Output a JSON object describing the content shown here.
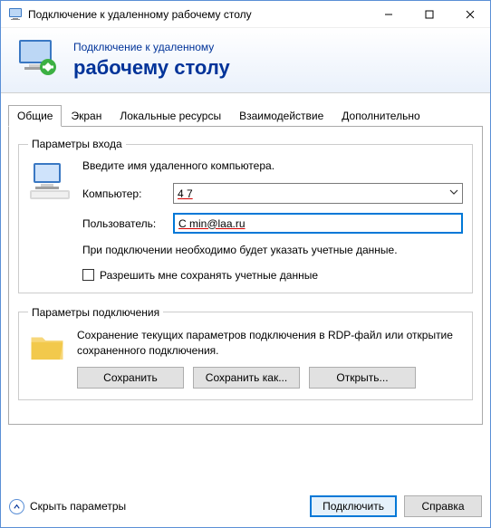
{
  "window": {
    "title": "Подключение к удаленному рабочему столу"
  },
  "header": {
    "line1": "Подключение к удаленному",
    "line2": "рабочему столу"
  },
  "tabs": {
    "general": "Общие",
    "display": "Экран",
    "localres": "Локальные ресурсы",
    "experience": "Взаимодействие",
    "advanced": "Дополнительно"
  },
  "logon": {
    "legend": "Параметры входа",
    "intro": "Введите имя удаленного компьютера.",
    "computer_label": "Компьютер:",
    "computer_value": "4                          7",
    "user_label": "Пользователь:",
    "user_value": "С             min@laa.ru",
    "note": "При подключении необходимо будет указать учетные данные.",
    "save_creds": "Разрешить мне сохранять учетные данные"
  },
  "conn": {
    "legend": "Параметры подключения",
    "text": "Сохранение текущих параметров подключения в RDP-файл или открытие сохраненного подключения.",
    "save": "Сохранить",
    "saveas": "Сохранить как...",
    "open": "Открыть..."
  },
  "footer": {
    "hide": "Скрыть параметры",
    "connect": "Подключить",
    "help": "Справка"
  }
}
